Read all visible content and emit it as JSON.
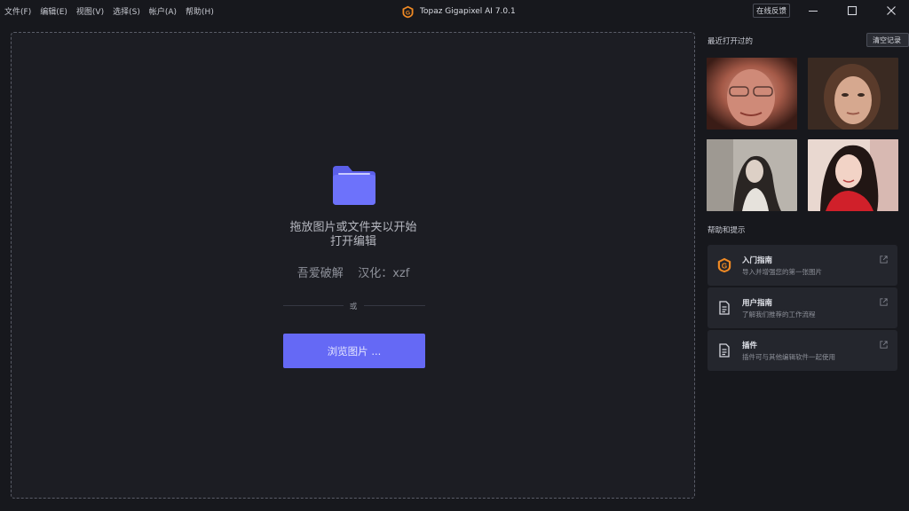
{
  "menu": [
    "文件(F)",
    "编辑(E)",
    "视图(V)",
    "选择(S)",
    "帐户(A)",
    "帮助(H)"
  ],
  "app": {
    "title": "Topaz Gigapixel AI 7.0.1",
    "logo_letter": "G"
  },
  "feedback_label": "在线反馈",
  "dropzone": {
    "line1": "拖放图片或文件夹以开始",
    "line2": "打开编辑",
    "crack": "吾爱破解    汉化：xzf",
    "or": "或",
    "browse": "浏览图片 ..."
  },
  "recent": {
    "heading": "最近打开过的",
    "clear": "清空记录",
    "thumbs": [
      "recent-image-1",
      "recent-image-2",
      "recent-image-3",
      "recent-image-4"
    ]
  },
  "help": {
    "heading": "帮助和提示",
    "items": [
      {
        "title": "入门指南",
        "desc": "导入并增强您的第一张图片",
        "icon": "gigapixel-logo-icon"
      },
      {
        "title": "用户指南",
        "desc": "了解我们推荐的工作流程",
        "icon": "document-icon"
      },
      {
        "title": "插件",
        "desc": "插件可与其他编辑软件一起使用",
        "icon": "document-icon"
      }
    ]
  },
  "colors": {
    "accent": "#6569f5",
    "logo": "#f08a24",
    "background": "#17181d"
  }
}
